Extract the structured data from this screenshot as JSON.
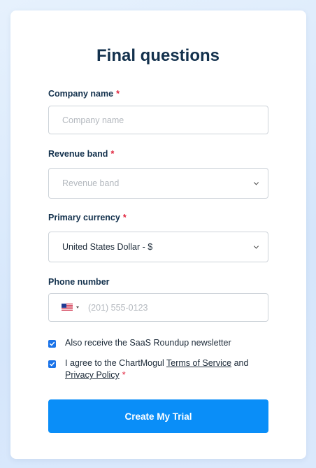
{
  "form": {
    "title": "Final questions",
    "required_mark": "*",
    "company": {
      "label": "Company name",
      "placeholder": "Company name"
    },
    "revenue": {
      "label": "Revenue band",
      "placeholder": "Revenue band"
    },
    "currency": {
      "label": "Primary currency",
      "value": "United States Dollar - $"
    },
    "phone": {
      "label": "Phone number",
      "country_flag": "us-flag-icon",
      "placeholder": "(201) 555-0123"
    },
    "newsletter": {
      "label": "Also receive the SaaS Roundup newsletter",
      "checked": true
    },
    "terms": {
      "prefix": "I agree to the ChartMogul",
      "terms_link": "Terms of Service",
      "middle": "and",
      "privacy_link": "Privacy Policy",
      "checked": true
    },
    "submit_label": "Create My Trial"
  },
  "colors": {
    "accent": "#0a8ef8",
    "checkbox": "#1a73e8",
    "required": "#e0243d",
    "heading": "#13314d"
  }
}
